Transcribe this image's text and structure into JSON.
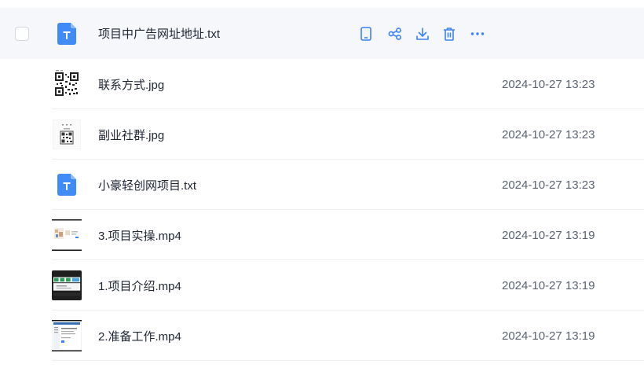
{
  "accent": "#3b82f6",
  "files": [
    {
      "name": "项目中广告网址地址.txt",
      "date": "",
      "type": "txt",
      "selected_hover": true
    },
    {
      "name": "联系方式.jpg",
      "date": "2024-10-27 13:23",
      "type": "qr"
    },
    {
      "name": "副业社群.jpg",
      "date": "2024-10-27 13:23",
      "type": "qr-small"
    },
    {
      "name": "小豪轻创网项目.txt",
      "date": "2024-10-27 13:23",
      "type": "txt"
    },
    {
      "name": "3.项目实操.mp4",
      "date": "2024-10-27 13:19",
      "type": "video-light"
    },
    {
      "name": "1.项目介绍.mp4",
      "date": "2024-10-27 13:19",
      "type": "video-dark"
    },
    {
      "name": "2.准备工作.mp4",
      "date": "2024-10-27 13:19",
      "type": "video-doc"
    }
  ],
  "hover_actions": [
    "phone-icon",
    "share-icon",
    "download-icon",
    "delete-icon",
    "more-icon"
  ]
}
